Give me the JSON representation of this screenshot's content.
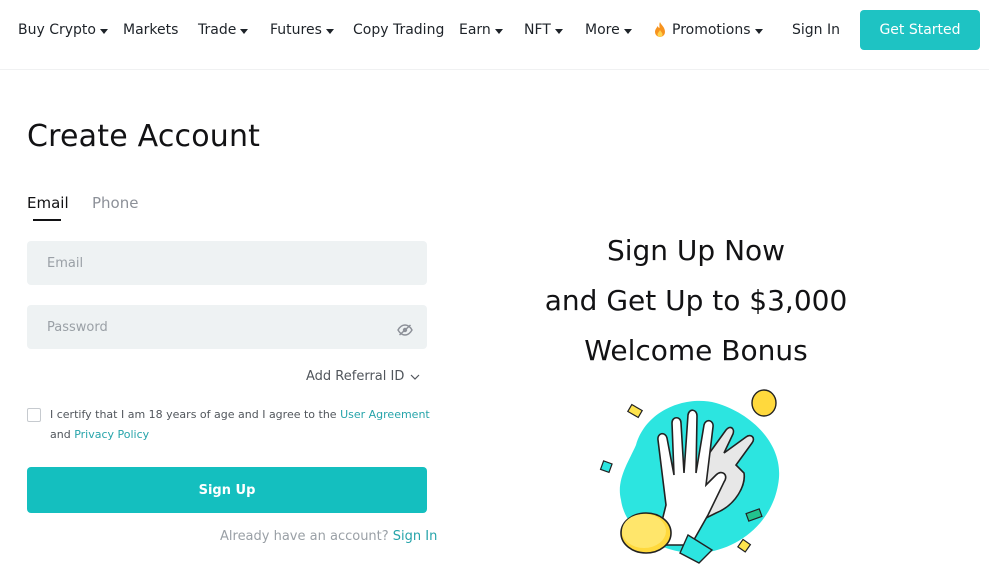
{
  "nav": {
    "items": [
      {
        "label": "Buy Crypto",
        "dropdown": true
      },
      {
        "label": "Markets",
        "dropdown": false
      },
      {
        "label": "Trade",
        "dropdown": true
      },
      {
        "label": "Futures",
        "dropdown": true
      },
      {
        "label": "Copy Trading",
        "dropdown": false
      },
      {
        "label": "Earn",
        "dropdown": true
      },
      {
        "label": "NFT",
        "dropdown": true
      },
      {
        "label": "More",
        "dropdown": true
      },
      {
        "label": "Promotions",
        "dropdown": true,
        "icon": "fire-icon"
      }
    ],
    "sign_in": "Sign In",
    "get_started": "Get Started"
  },
  "form": {
    "title": "Create Account",
    "tabs": [
      {
        "label": "Email",
        "active": true
      },
      {
        "label": "Phone",
        "active": false
      }
    ],
    "email_placeholder": "Email",
    "password_placeholder": "Password",
    "password_icon": "eye-hidden-icon",
    "referral_label": "Add Referral ID",
    "agree_text_1": "I certify that I am 18 years of age and I agree to the ",
    "agree_link_1": "User Agreement",
    "agree_text_2": "and ",
    "agree_link_2": "Privacy Policy",
    "submit_label": "Sign Up",
    "already_text": "Already have an account? ",
    "already_link": "Sign In"
  },
  "promo": {
    "line1": "Sign Up Now",
    "line2": "and Get Up to $3,000",
    "line3": "Welcome Bonus",
    "illustration": "high-five-hands-coins-illustration"
  },
  "colors": {
    "accent": "#14bfbf",
    "link": "#26a4aa",
    "field_bg": "#eef2f3",
    "text": "#121214",
    "muted": "#9aa0a6"
  }
}
